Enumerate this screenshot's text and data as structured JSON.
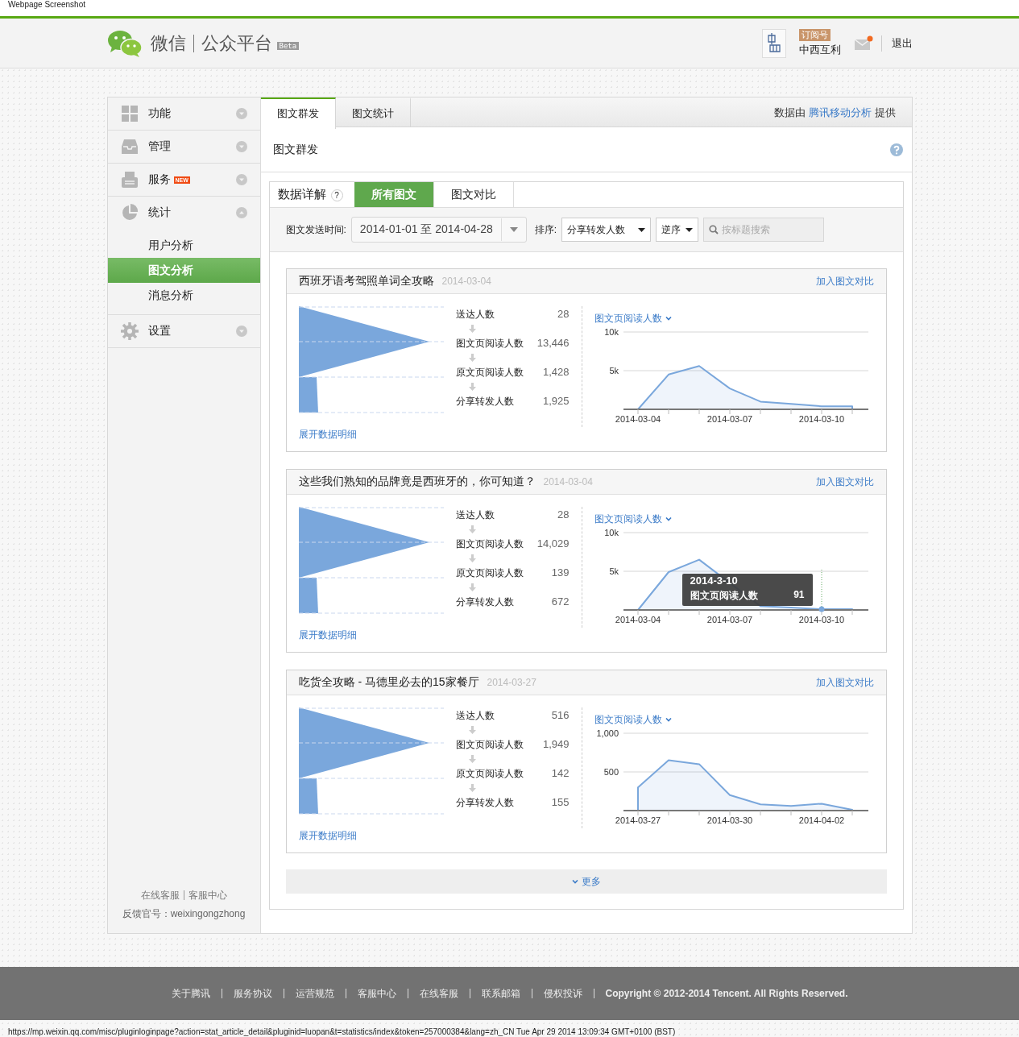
{
  "capture_title": "Webpage Screenshot",
  "header": {
    "logo": "微信",
    "product": "公众平台",
    "badge": "Beta",
    "account_type": "订阅号",
    "account_name": "中西互利",
    "mail_unread": true,
    "logout": "退出"
  },
  "sidebar": {
    "items": [
      {
        "label": "功能",
        "expanded": false
      },
      {
        "label": "管理",
        "expanded": false
      },
      {
        "label": "服务",
        "expanded": false,
        "badge": "NEW"
      },
      {
        "label": "统计",
        "expanded": true,
        "children": [
          {
            "label": "用户分析",
            "selected": false
          },
          {
            "label": "图文分析",
            "selected": true
          },
          {
            "label": "消息分析",
            "selected": false
          }
        ]
      },
      {
        "label": "设置",
        "expanded": false
      }
    ],
    "support_links": [
      "在线客服",
      "客服中心"
    ],
    "feedback": "反馈官号：weixingongzhong"
  },
  "main": {
    "tabs": [
      {
        "label": "图文群发",
        "selected": true
      },
      {
        "label": "图文统计",
        "selected": false
      }
    ],
    "provider": {
      "prefix": "数据由",
      "link": "腾讯移动分析",
      "suffix": "提供"
    },
    "title": "图文群发",
    "panel": {
      "title": "数据详解",
      "help": "?",
      "tabs": [
        {
          "label": "所有图文",
          "selected": true
        },
        {
          "label": "图文对比",
          "selected": false
        }
      ],
      "filters": {
        "date_label": "图文发送时间:",
        "date_range": "2014-01-01 至 2014-04-28",
        "sort_label": "排序:",
        "sort_value": "分享转发人数",
        "order_value": "逆序",
        "search_placeholder": "按标题搜索"
      },
      "articles": [
        {
          "title": "西班牙语考驾照单词全攻略",
          "date": "2014-03-04",
          "compare_link": "加入图文对比",
          "detail_link": "展开数据明细",
          "metrics": [
            {
              "label": "送达人数",
              "value": "28"
            },
            {
              "label": "图文页阅读人数",
              "value": "13,446"
            },
            {
              "label": "原文页阅读人数",
              "value": "1,428"
            },
            {
              "label": "分享转发人数",
              "value": "1,925"
            }
          ],
          "chart_data": {
            "type": "area",
            "categories": [
              "2014-03-04",
              null,
              null,
              "2014-03-07",
              null,
              null,
              "2014-03-10",
              null
            ],
            "series": [
              {
                "name": "图文页阅读人数",
                "color": "#7aa7dc",
                "values": [
                  0,
                  4500,
                  5600,
                  2700,
                  1000,
                  700,
                  400,
                  400
                ]
              }
            ],
            "ylim": [
              0,
              10000
            ],
            "yticks": [
              {
                "value": 5000,
                "label": "5k"
              },
              {
                "value": 10000,
                "label": "10k"
              }
            ]
          }
        },
        {
          "title": "这些我们熟知的品牌竟是西班牙的，你可知道？",
          "date": "2014-03-04",
          "compare_link": "加入图文对比",
          "detail_link": "展开数据明细",
          "metrics": [
            {
              "label": "送达人数",
              "value": "28"
            },
            {
              "label": "图文页阅读人数",
              "value": "14,029"
            },
            {
              "label": "原文页阅读人数",
              "value": "139"
            },
            {
              "label": "分享转发人数",
              "value": "672"
            }
          ],
          "chart_data": {
            "type": "area",
            "categories": [
              "2014-03-04",
              null,
              null,
              "2014-03-07",
              null,
              null,
              "2014-03-10",
              null
            ],
            "series": [
              {
                "name": "图文页阅读人数",
                "color": "#7aa7dc",
                "values": [
                  0,
                  4900,
                  6500,
                  null,
                  500,
                  300,
                  100,
                  100
                ]
              }
            ],
            "ylim": [
              0,
              10000
            ],
            "yticks": [
              {
                "value": 5000,
                "label": "5k"
              },
              {
                "value": 10000,
                "label": "10k"
              }
            ]
          },
          "tooltip": {
            "date": "2014-3-10",
            "label": "图文页阅读人数",
            "value": "91"
          }
        },
        {
          "title": "吃货全攻略 - 马德里必去的15家餐厅",
          "date": "2014-03-27",
          "compare_link": "加入图文对比",
          "detail_link": "展开数据明细",
          "metrics": [
            {
              "label": "送达人数",
              "value": "516"
            },
            {
              "label": "图文页阅读人数",
              "value": "1,949"
            },
            {
              "label": "原文页阅读人数",
              "value": "142"
            },
            {
              "label": "分享转发人数",
              "value": "155"
            }
          ],
          "chart_data": {
            "type": "area",
            "categories": [
              "2014-03-27",
              null,
              null,
              "2014-03-30",
              null,
              null,
              "2014-04-02",
              null
            ],
            "series": [
              {
                "name": "图文页阅读人数",
                "color": "#7aa7dc",
                "values": [
                  300,
                  650,
                  600,
                  200,
                  80,
                  60,
                  90,
                  10
                ]
              }
            ],
            "ylim": [
              0,
              1000
            ],
            "yticks": [
              {
                "value": 500,
                "label": "500"
              },
              {
                "value": 1000,
                "label": "1,000"
              }
            ]
          }
        }
      ],
      "more": "更多"
    }
  },
  "footer": {
    "links": [
      "关于腾讯",
      "服务协议",
      "运营规范",
      "客服中心",
      "在线客服",
      "联系邮箱",
      "侵权投诉"
    ],
    "copyright": "Copyright © 2012-2014 Tencent. All Rights Reserved."
  },
  "capture_url": "https://mp.weixin.qq.com/misc/pluginloginpage?action=stat_article_detail&pluginid=luopan&t=statistics/index&token=257000384&lang=zh_CN Tue Apr 29 2014 13:09:34 GMT+0100 (BST)"
}
